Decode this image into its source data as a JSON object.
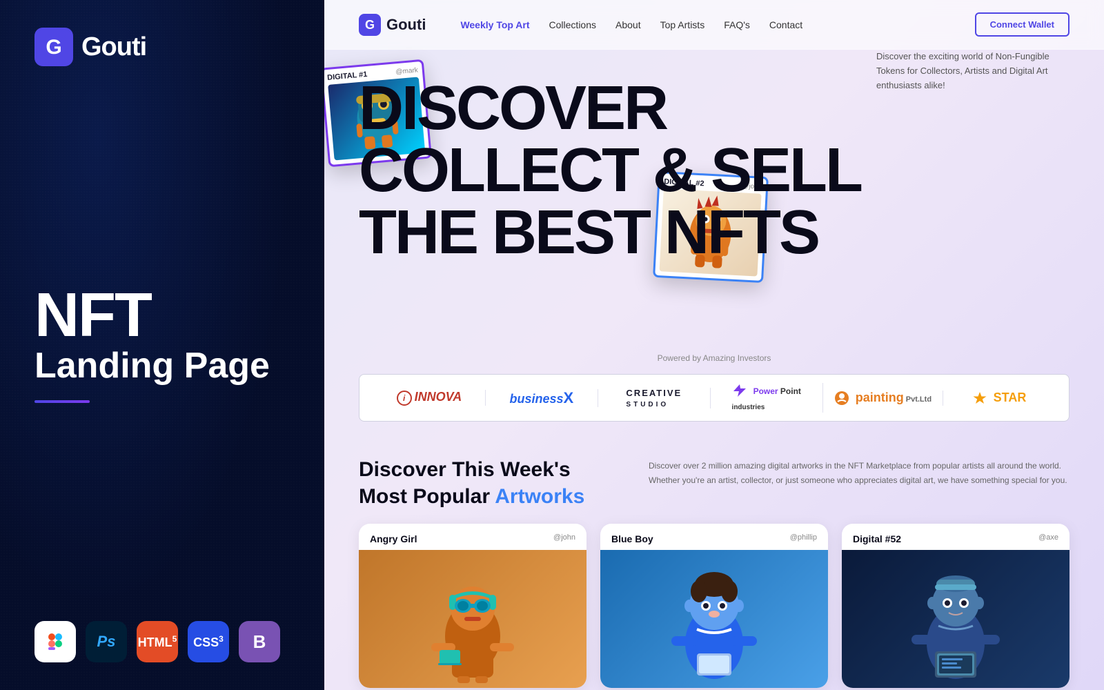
{
  "left": {
    "brand": {
      "name": "Gouti"
    },
    "title_nft": "NFT",
    "title_landing": "Landing Page",
    "tech_icons": [
      {
        "name": "figma",
        "label": "Figma",
        "symbol": "❖",
        "bg": "#fff",
        "color": "#333"
      },
      {
        "name": "photoshop",
        "label": "Adobe Photoshop",
        "symbol": "Ps",
        "bg": "#001e36",
        "color": "#31a8ff"
      },
      {
        "name": "html5",
        "label": "HTML5",
        "symbol": "5",
        "bg": "#e34c26",
        "color": "#fff"
      },
      {
        "name": "css3",
        "label": "CSS3",
        "symbol": "3",
        "bg": "#264de4",
        "color": "#fff"
      },
      {
        "name": "bootstrap",
        "label": "Bootstrap",
        "symbol": "B",
        "bg": "#7952b3",
        "color": "#fff"
      }
    ]
  },
  "nav": {
    "brand": "Gouti",
    "links": [
      {
        "label": "Weekly Top Art",
        "active": true
      },
      {
        "label": "Collections",
        "active": false
      },
      {
        "label": "About",
        "active": false
      },
      {
        "label": "Top Artists",
        "active": false
      },
      {
        "label": "FAQ's",
        "active": false
      },
      {
        "label": "Contact",
        "active": false
      }
    ],
    "connect_btn": "Connect Wallet"
  },
  "hero": {
    "line1": "DISCOVER",
    "line2": "COLLECT & SELL",
    "line3": "THE BEST NFTs",
    "description": "Discover the exciting world of Non-Fungible Tokens for Collectors, Artists and Digital Art enthusiasts alike!",
    "card1": {
      "label": "DIGITAL #1",
      "handle": "@mark"
    },
    "card2": {
      "label": "DIGITAL #2",
      "handle": "@john"
    }
  },
  "investors": {
    "label": "Powered by Amazing Investors",
    "items": [
      {
        "name": "INNOVA",
        "style": "innova"
      },
      {
        "name": "businessX",
        "style": "business"
      },
      {
        "name": "CREATIVE STUDIO",
        "style": "creative"
      },
      {
        "name": "⚡ Power Point Industries",
        "style": "power"
      },
      {
        "name": "🎨 painting Pvt.Ltd",
        "style": "painting"
      },
      {
        "name": "⭐ STAR",
        "style": "star"
      }
    ]
  },
  "discover": {
    "title_part1": "Discover This Week's Most Popular ",
    "title_highlight": "Artworks",
    "description": "Discover over 2 million amazing digital artworks in the NFT Marketplace from popular artists all around the world. Whether you're an artist, collector, or just someone who appreciates digital art, we have something special for you."
  },
  "artworks": [
    {
      "title": "Angry Girl",
      "handle": "@john",
      "bg": "angry-girl",
      "char": "🤖"
    },
    {
      "title": "Blue Boy",
      "handle": "@phillip",
      "bg": "blue-boy",
      "char": "🧒"
    },
    {
      "title": "Digital #52",
      "handle": "@axe",
      "bg": "digital52",
      "char": "👦"
    }
  ],
  "colors": {
    "accent": "#4f46e5",
    "blue": "#3b82f6",
    "purple": "#7c3aed"
  }
}
